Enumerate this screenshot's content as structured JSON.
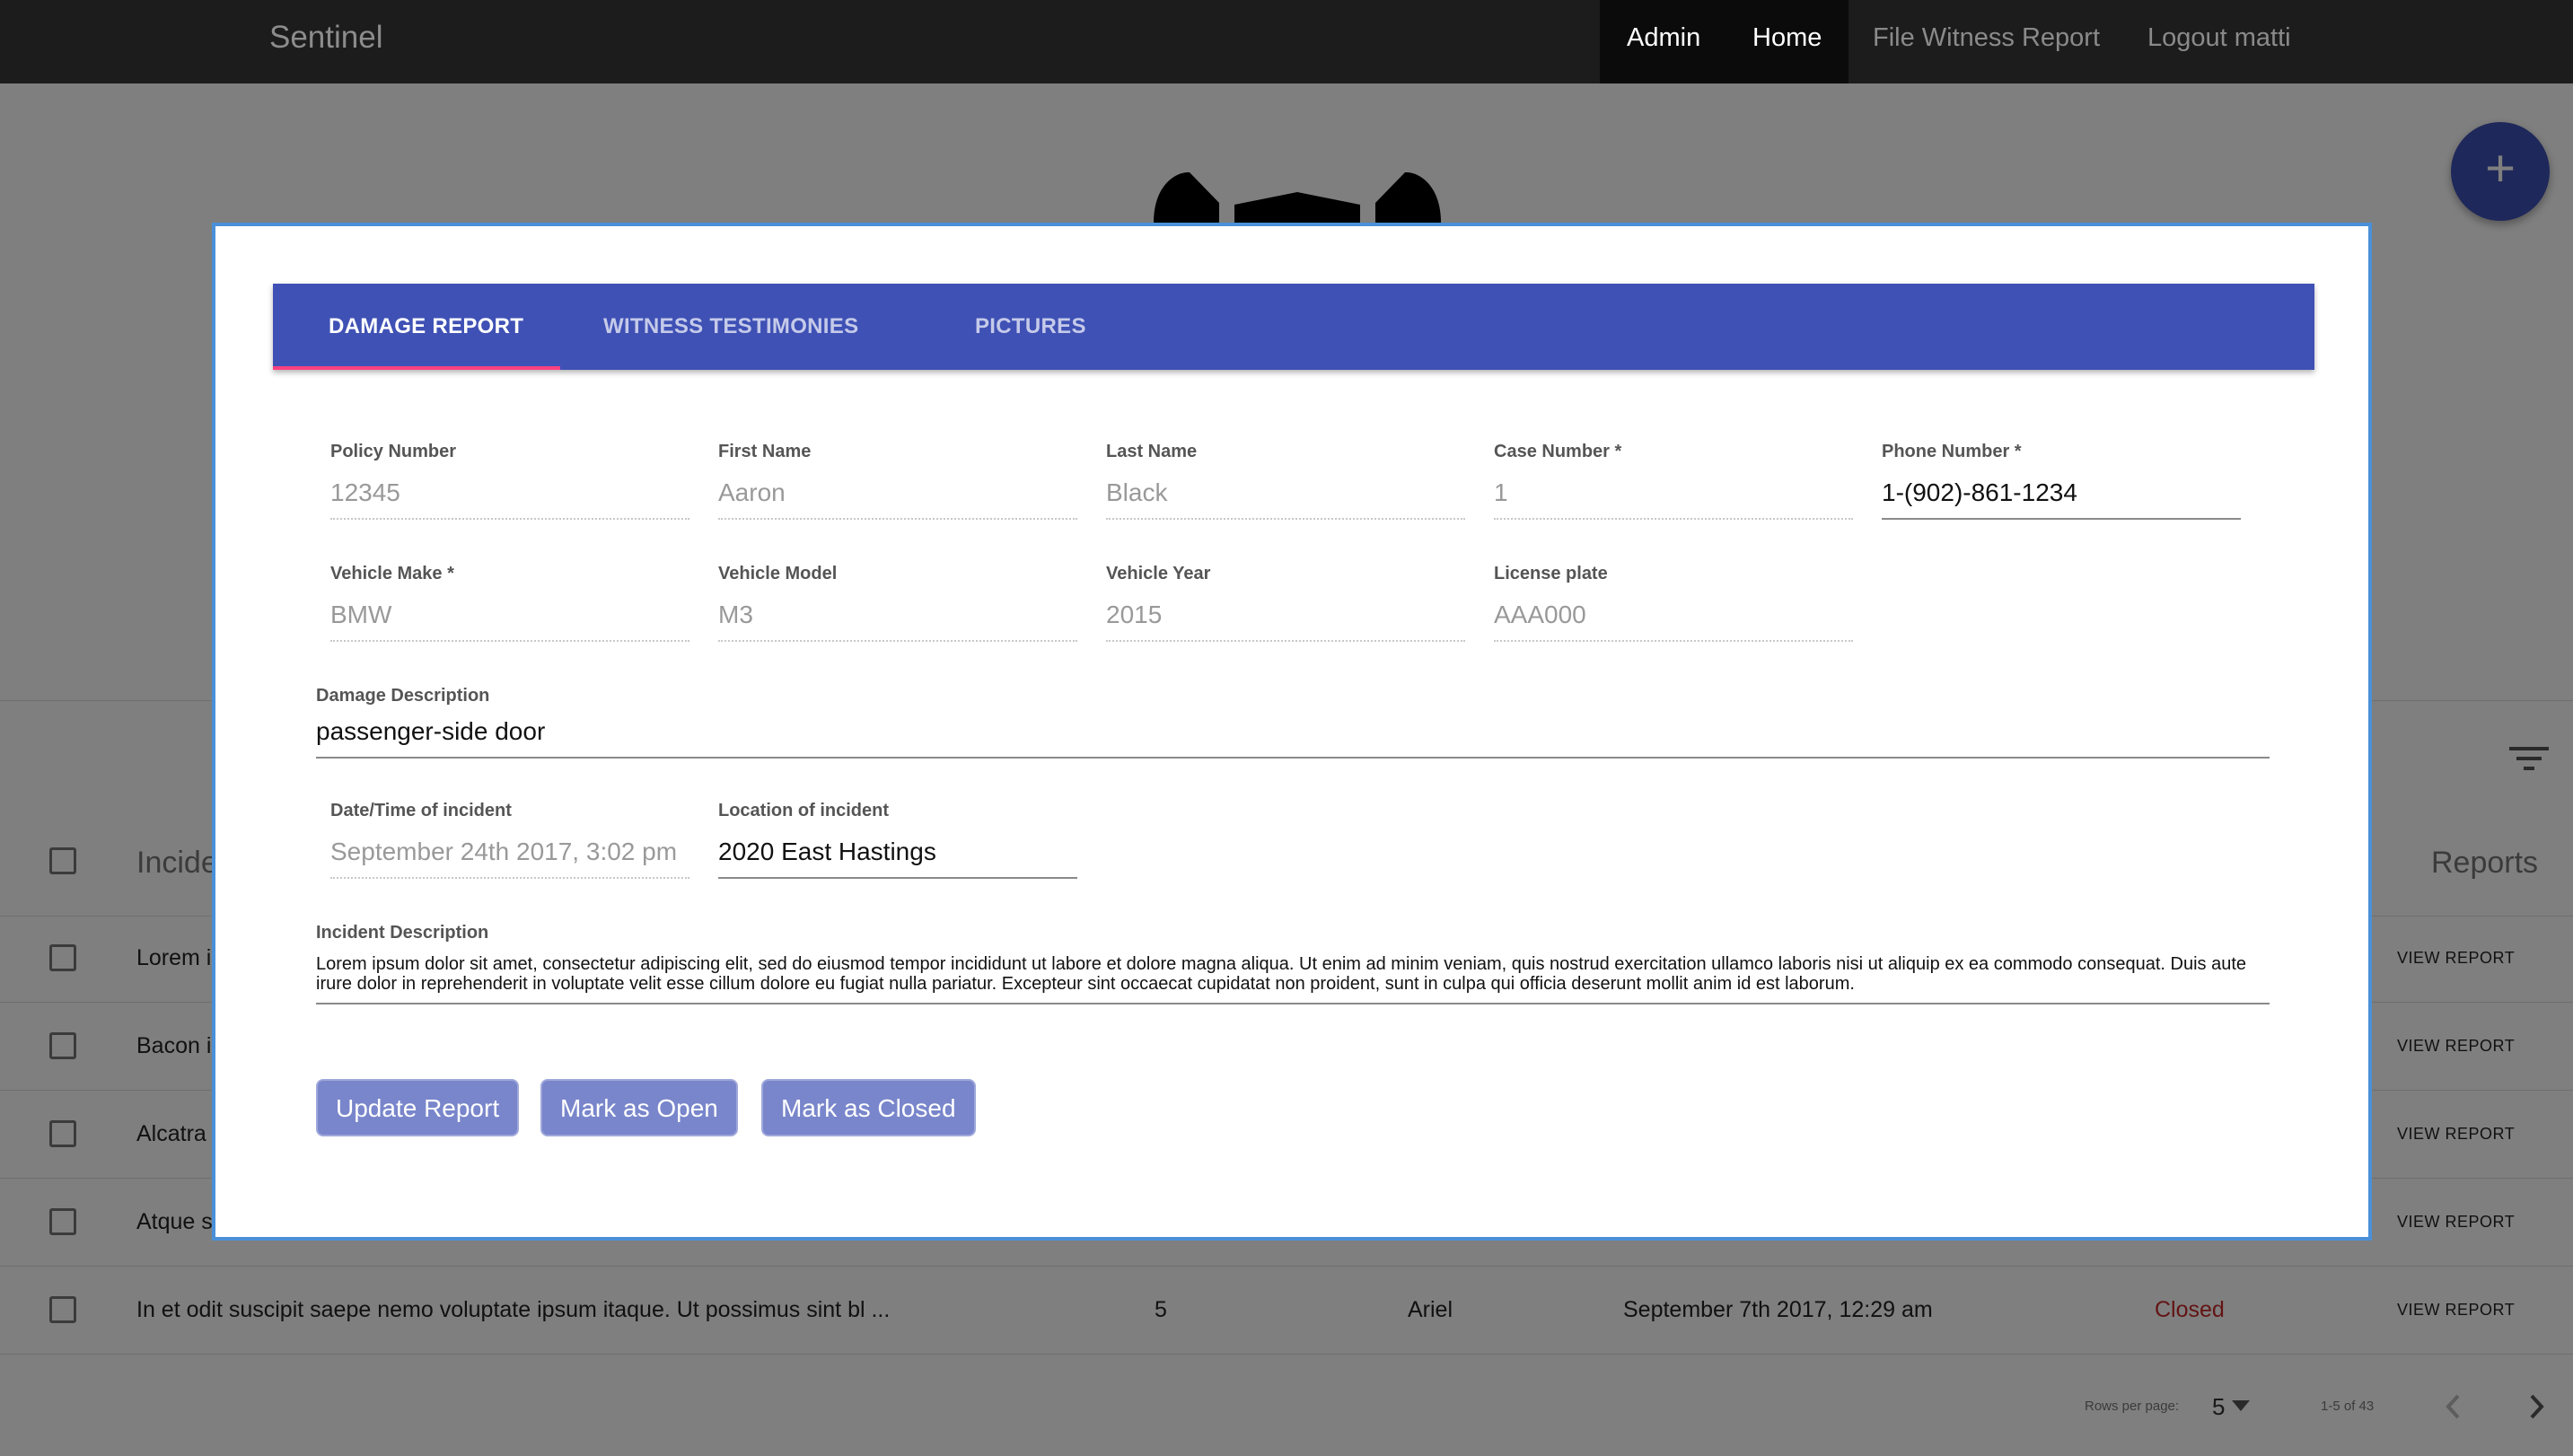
{
  "navbar": {
    "brand": "Sentinel",
    "items": [
      {
        "label": "Admin"
      },
      {
        "label": "Home"
      },
      {
        "label": "File Witness Report"
      },
      {
        "label": "Logout matti"
      }
    ]
  },
  "background": {
    "fab_icon": "+",
    "table": {
      "header_incidents": "Incide",
      "header_reports": "Reports",
      "rows": [
        {
          "incident": "Lorem i",
          "action": "VIEW REPORT"
        },
        {
          "incident": "Bacon i",
          "action": "VIEW REPORT"
        },
        {
          "incident": "Alcatra",
          "action": "VIEW REPORT"
        },
        {
          "incident": "Atque s",
          "action": "VIEW REPORT"
        },
        {
          "incident": "In et odit suscipit saepe nemo voluptate ipsum itaque. Ut possimus sint bl ...",
          "count": "5",
          "name": "Ariel",
          "date": "September 7th 2017, 12:29 am",
          "status": "Closed",
          "action": "VIEW REPORT"
        }
      ]
    },
    "footer": {
      "rows_per_page_label": "Rows per page:",
      "rows_per_page_value": "5",
      "range": "1-5 of 43"
    }
  },
  "modal": {
    "tabs": [
      {
        "label": "DAMAGE REPORT"
      },
      {
        "label": "WITNESS TESTIMONIES"
      },
      {
        "label": "PICTURES"
      }
    ],
    "fields": {
      "policy_number": {
        "label": "Policy Number",
        "value": "12345"
      },
      "first_name": {
        "label": "First Name",
        "value": "Aaron"
      },
      "last_name": {
        "label": "Last Name",
        "value": "Black"
      },
      "case_number": {
        "label": "Case Number *",
        "value": "1"
      },
      "phone_number": {
        "label": "Phone Number *",
        "value": "1-(902)-861-1234"
      },
      "vehicle_make": {
        "label": "Vehicle Make *",
        "value": "BMW"
      },
      "vehicle_model": {
        "label": "Vehicle Model",
        "value": "M3"
      },
      "vehicle_year": {
        "label": "Vehicle Year",
        "value": "2015"
      },
      "license_plate": {
        "label": "License plate",
        "value": "AAA000"
      },
      "damage_description": {
        "label": "Damage Description",
        "value": "passenger-side door"
      },
      "datetime": {
        "label": "Date/Time of incident",
        "value": "September 24th 2017, 3:02 pm"
      },
      "location": {
        "label": "Location of incident",
        "value": "2020 East Hastings"
      },
      "incident_description": {
        "label": "Incident Description",
        "value": "Lorem ipsum dolor sit amet, consectetur adipiscing elit, sed do eiusmod tempor incididunt ut labore et dolore magna aliqua. Ut enim ad minim veniam, quis nostrud exercitation ullamco laboris nisi ut aliquip ex ea commodo consequat. Duis aute irure dolor in reprehenderit in voluptate velit esse cillum dolore eu fugiat nulla pariatur. Excepteur sint occaecat cupidatat non proident, sunt in culpa qui officia deserunt mollit anim id est laborum."
      }
    },
    "buttons": {
      "update": "Update Report",
      "open": "Mark as Open",
      "closed": "Mark as Closed"
    }
  },
  "colors": {
    "primary": "#3f51b5",
    "tab_indicator": "#ff4081",
    "button": "#7986cb",
    "status_closed": "#c62828"
  }
}
